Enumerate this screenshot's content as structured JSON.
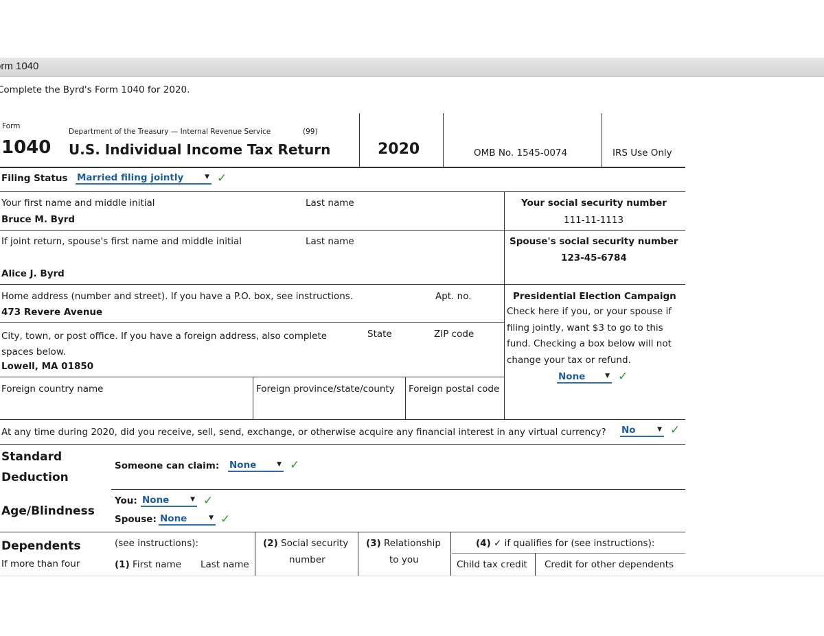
{
  "window": {
    "title": "orm 1040"
  },
  "instruction": "Complete the Byrd's Form 1040 for 2020.",
  "header": {
    "form_label": "Form",
    "department": "Department of the Treasury — Internal Revenue Service",
    "code": "(99)",
    "form_number": "1040",
    "title": "U.S. Individual Income Tax Return",
    "year": "2020",
    "omb": "OMB No. 1545-0074",
    "irs_use": "IRS Use Only"
  },
  "filing_status": {
    "label": "Filing Status",
    "value": "Married filing jointly"
  },
  "taxpayer": {
    "first_name_label": "Your first name and middle initial",
    "last_name_label": "Last name",
    "name": "Bruce M. Byrd",
    "ssn_label": "Your social security number",
    "ssn": "111-11-1113"
  },
  "spouse": {
    "first_name_label": "If joint return, spouse's first name and middle initial",
    "last_name_label": "Last name",
    "name": "Alice J. Byrd",
    "ssn_label": "Spouse's social security number",
    "ssn": "123-45-6784"
  },
  "address": {
    "home_label": "Home address (number and street). If you have a P.O. box, see instructions.",
    "apt_label": "Apt. no.",
    "home": "473 Revere Avenue",
    "city_label": "City, town, or post office. If you have a foreign address, also complete spaces below.",
    "state_label": "State",
    "zip_label": "ZIP code",
    "city": "Lowell, MA 01850",
    "foreign_country_label": "Foreign country name",
    "foreign_province_label": "Foreign province/state/county",
    "foreign_postal_label": "Foreign postal code"
  },
  "campaign": {
    "title": "Presidential Election Campaign",
    "text": "Check here if you, or your spouse if filing jointly, want $3 to go to this fund. Checking a box below will not change your tax or refund.",
    "value": "None"
  },
  "virtual_currency": {
    "question": "At any time during 2020, did you receive, sell, send, exchange, or otherwise acquire any financial interest in any virtual currency?",
    "value": "No"
  },
  "standard_deduction": {
    "label_line1": "Standard",
    "label_line2": "Deduction",
    "claim_label": "Someone can claim:",
    "value": "None"
  },
  "age_blindness": {
    "label": "Age/Blindness",
    "you_label": "You:",
    "you_value": "None",
    "spouse_label": "Spouse:",
    "spouse_value": "None"
  },
  "dependents": {
    "label": "Dependents",
    "sublabel": "If more than four",
    "see_instructions": "(see instructions):",
    "col1_num": "(1)",
    "col1_first": "First name",
    "col1_last": "Last name",
    "col2_num": "(2)",
    "col2_line1": "Social security",
    "col2_line2": "number",
    "col3_num": "(3)",
    "col3_line1": "Relationship",
    "col3_line2": "to you",
    "col4_num": "(4)",
    "col4_text": "✓ if qualifies for (see instructions):",
    "col4_child": "Child tax credit",
    "col4_other": "Credit for other dependents"
  },
  "icons": {
    "check": "check-icon",
    "dropdown": "dropdown-arrow-icon"
  },
  "colors": {
    "select_text": "#1c5d9a",
    "check": "#2e9b2e"
  }
}
